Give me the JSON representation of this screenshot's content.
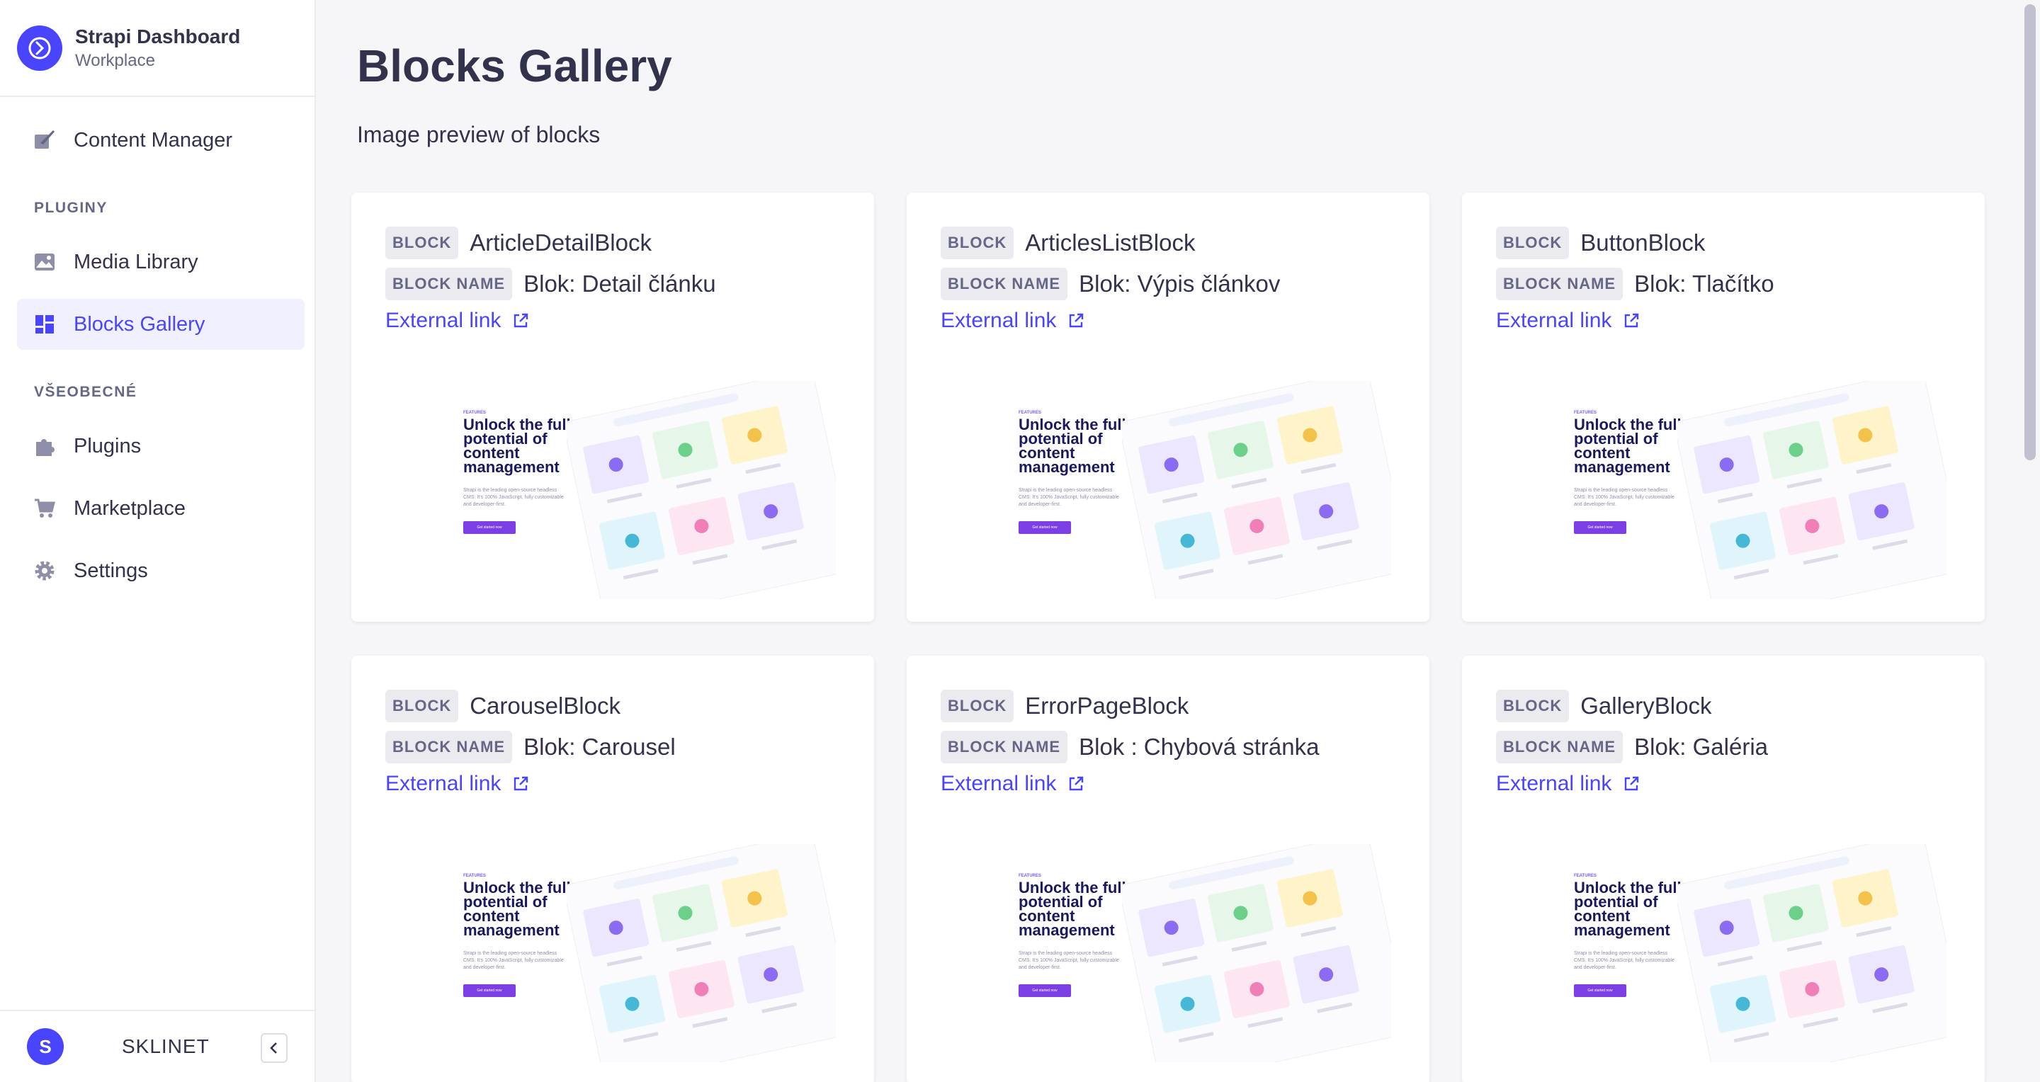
{
  "sidebar": {
    "brand_title": "Strapi Dashboard",
    "brand_subtitle": "Workplace",
    "items": {
      "content_manager": "Content Manager",
      "section_plugins": "PLUGINY",
      "media_library": "Media Library",
      "blocks_gallery": "Blocks Gallery",
      "section_general": "VŠEOBECNÉ",
      "plugins": "Plugins",
      "marketplace": "Marketplace",
      "settings": "Settings"
    },
    "user_initial": "S",
    "user_name": "SKLINET"
  },
  "main": {
    "title": "Blocks Gallery",
    "subtitle": "Image preview of blocks"
  },
  "labels": {
    "block": "BLOCK",
    "block_name": "BLOCK NAME",
    "external_link": "External link"
  },
  "preview": {
    "tag": "FEATURES",
    "headline": "Unlock the full potential of content management",
    "copy": "Strapi is the leading open-source headless CMS. It's 100% JavaScript, fully customizable and developer-first.",
    "button": "Get started now"
  },
  "cards": [
    {
      "block": "ArticleDetailBlock",
      "name": "Blok: Detail článku"
    },
    {
      "block": "ArticlesListBlock",
      "name": "Blok: Výpis článkov"
    },
    {
      "block": "ButtonBlock",
      "name": "Blok: Tlačítko"
    },
    {
      "block": "CarouselBlock",
      "name": "Blok: Carousel"
    },
    {
      "block": "ErrorPageBlock",
      "name": "Blok : Chybová stránka"
    },
    {
      "block": "GalleryBlock",
      "name": "Blok: Galéria"
    }
  ],
  "colors": {
    "accent": "#4945ff",
    "text": "#32324d",
    "muted": "#666687",
    "background": "#f6f6f9"
  }
}
